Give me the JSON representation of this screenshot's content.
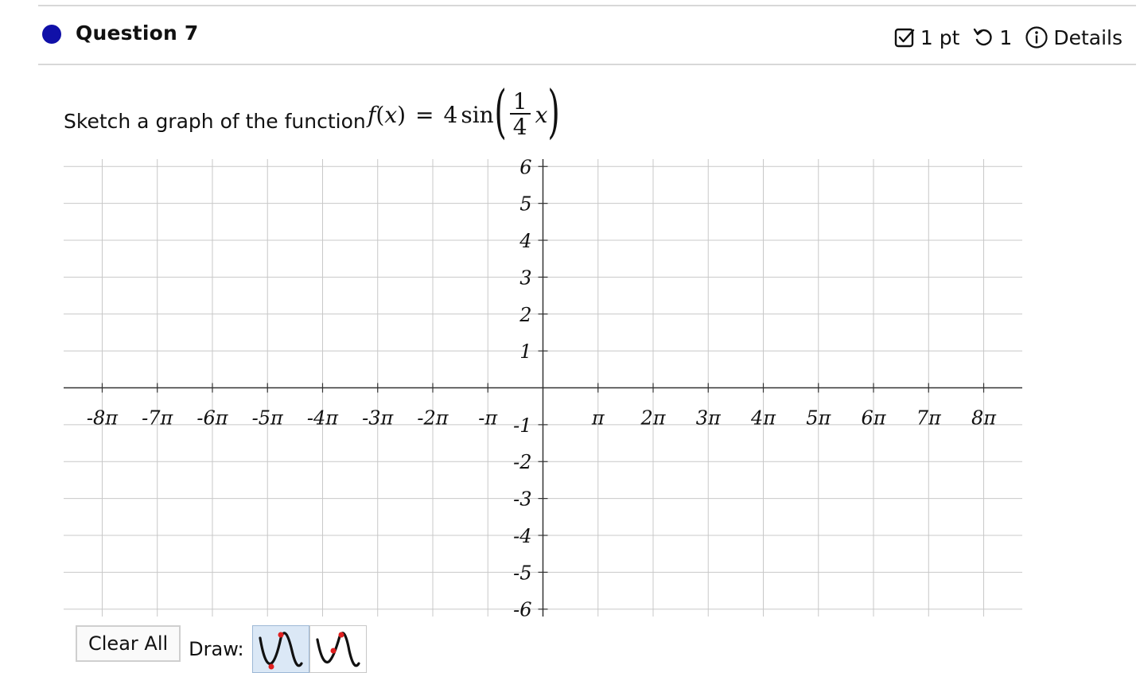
{
  "header": {
    "title": "Question 7",
    "points": "1 pt",
    "attempts": "1",
    "details_label": "Details",
    "icons": [
      "question-status-dot",
      "checkbox-icon",
      "retry-icon",
      "info-icon"
    ]
  },
  "question": {
    "prompt": "Sketch a graph of the function",
    "formula": {
      "lhs_fn": "f",
      "lhs_var": "x",
      "eq": "=",
      "coef": "4",
      "func": "sin",
      "num": "1",
      "den": "4",
      "arg": "x"
    }
  },
  "graph": {
    "x_labels": [
      "-8π",
      "-7π",
      "-6π",
      "-5π",
      "-4π",
      "-3π",
      "-2π",
      "-π",
      "π",
      "2π",
      "3π",
      "4π",
      "5π",
      "6π",
      "7π",
      "8π"
    ],
    "x_values": [
      -8,
      -7,
      -6,
      -5,
      -4,
      -3,
      -2,
      -1,
      1,
      2,
      3,
      4,
      5,
      6,
      7,
      8
    ],
    "x_range": [
      -8.7,
      8.7
    ],
    "y_labels": [
      "6",
      "5",
      "4",
      "3",
      "2",
      "1",
      "-1",
      "-2",
      "-3",
      "-4",
      "-5",
      "-6"
    ],
    "y_values": [
      6,
      5,
      4,
      3,
      2,
      1,
      -1,
      -2,
      -3,
      -4,
      -5,
      -6
    ],
    "y_range": [
      -6.2,
      6.2
    ],
    "grid": true,
    "grid_color": "#c8c8c8",
    "axis_color": "#333333"
  },
  "toolbar": {
    "clear_label": "Clear All",
    "draw_label": "Draw:",
    "tools": [
      {
        "name": "sine-tool",
        "active": true
      },
      {
        "name": "sine-tool-alt",
        "active": false
      }
    ]
  }
}
